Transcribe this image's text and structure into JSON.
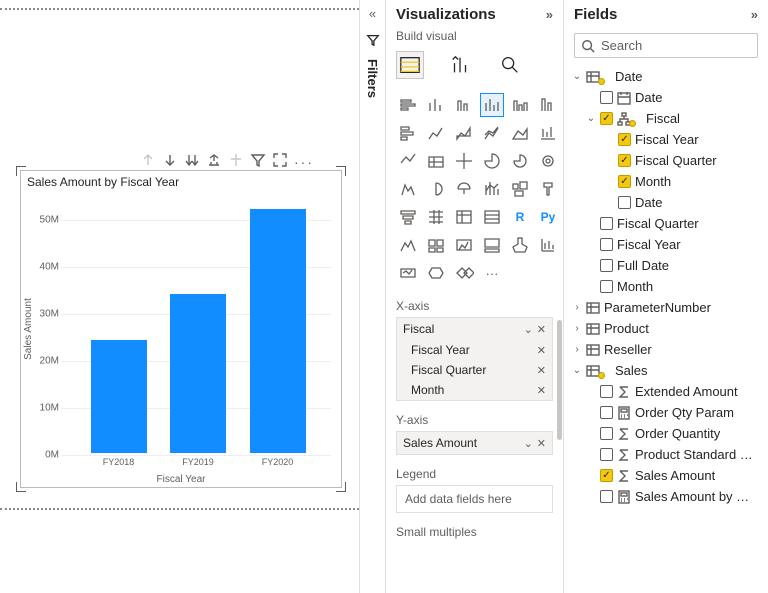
{
  "panes": {
    "filters_label": "Filters",
    "viz_title": "Visualizations",
    "build_label": "Build visual",
    "fields_title": "Fields",
    "search_placeholder": "Search"
  },
  "chart_data": {
    "type": "bar",
    "title": "Sales Amount by Fiscal Year",
    "xlabel": "Fiscal Year",
    "ylabel": "Sales Amount",
    "categories": [
      "FY2018",
      "FY2019",
      "FY2020"
    ],
    "values": [
      24000000,
      34000000,
      52000000
    ],
    "ylim": [
      0,
      55000000
    ],
    "yticks_labels": [
      "0M",
      "10M",
      "20M",
      "30M",
      "40M",
      "50M"
    ],
    "yticks_values": [
      0,
      10000000,
      20000000,
      30000000,
      40000000,
      50000000
    ]
  },
  "wells": {
    "xaxis": {
      "label": "X-axis",
      "group": "Fiscal",
      "items": [
        "Fiscal Year",
        "Fiscal Quarter",
        "Month"
      ]
    },
    "yaxis": {
      "label": "Y-axis",
      "items": [
        "Sales Amount"
      ]
    },
    "legend": {
      "label": "Legend",
      "placeholder": "Add data fields here"
    },
    "small_multiples": {
      "label": "Small multiples"
    }
  },
  "tables": [
    {
      "name": "Date",
      "expanded": true,
      "selected": true,
      "children": [
        {
          "name": "Date",
          "checked": false,
          "icon": "calendar"
        },
        {
          "name": "Fiscal",
          "checked": true,
          "icon": "hierarchy",
          "expanded": true,
          "selected": true,
          "children": [
            {
              "name": "Fiscal Year",
              "checked": true
            },
            {
              "name": "Fiscal Quarter",
              "checked": true
            },
            {
              "name": "Month",
              "checked": true
            },
            {
              "name": "Date",
              "checked": false
            }
          ]
        },
        {
          "name": "Fiscal Quarter",
          "checked": false
        },
        {
          "name": "Fiscal Year",
          "checked": false
        },
        {
          "name": "Full Date",
          "checked": false
        },
        {
          "name": "Month",
          "checked": false
        }
      ]
    },
    {
      "name": "ParameterNumber",
      "expanded": false
    },
    {
      "name": "Product",
      "expanded": false
    },
    {
      "name": "Reseller",
      "expanded": false
    },
    {
      "name": "Sales",
      "expanded": true,
      "selected": true,
      "children": [
        {
          "name": "Extended Amount",
          "checked": false,
          "icon": "sigma"
        },
        {
          "name": "Order Qty Param",
          "checked": false,
          "icon": "calc"
        },
        {
          "name": "Order Quantity",
          "checked": false,
          "icon": "sigma"
        },
        {
          "name": "Product Standard Cost",
          "checked": false,
          "icon": "sigma"
        },
        {
          "name": "Sales Amount",
          "checked": true,
          "icon": "sigma"
        },
        {
          "name": "Sales Amount by Du...",
          "checked": false,
          "icon": "calc"
        }
      ]
    }
  ]
}
